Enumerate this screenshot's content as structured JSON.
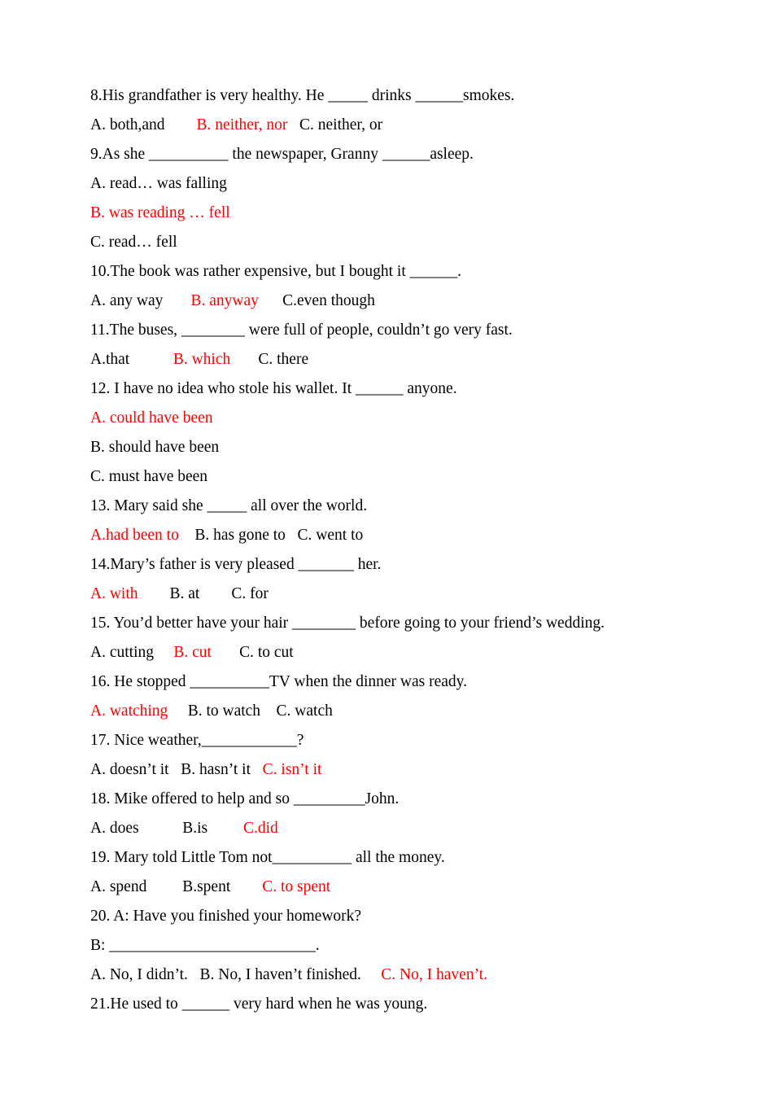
{
  "document": {
    "type": "grammar-multiple-choice-worksheet",
    "accent_color": "#FF0000",
    "text_color": "#000000",
    "background_color": "#FFFFFF",
    "lines": [
      {
        "id": "q8",
        "kind": "question",
        "text": "8.His grandfather is very healthy. He _____ drinks ______smokes."
      },
      {
        "id": "q8-opts",
        "kind": "options",
        "a": "A. both,and",
        "a_red": false,
        "b": "B. neither, nor",
        "b_red": true,
        "c": "C. neither, or",
        "c_red": false,
        "gap1": "        ",
        "gap2": "   "
      },
      {
        "id": "q9",
        "kind": "question",
        "text": "9.As she __________ the newspaper, Granny ______asleep."
      },
      {
        "id": "q9-a",
        "kind": "option-single",
        "text": "A. read… was falling",
        "red": false
      },
      {
        "id": "q9-b",
        "kind": "option-single",
        "text": "B. was reading … fell",
        "red": true
      },
      {
        "id": "q9-c",
        "kind": "option-single",
        "text": "C. read… fell",
        "red": false
      },
      {
        "id": "q10",
        "kind": "question",
        "text": "10.The book was rather expensive, but I bought it ______."
      },
      {
        "id": "q10-opts",
        "kind": "options",
        "a": "A. any way",
        "a_red": false,
        "b": "B. anyway",
        "b_red": true,
        "c": "C.even though",
        "c_red": false,
        "gap1": "       ",
        "gap2": "      "
      },
      {
        "id": "q11",
        "kind": "question",
        "text": "11.The buses, ________ were full of people, couldn’t go very fast."
      },
      {
        "id": "q11-opts",
        "kind": "options",
        "a": "A.that",
        "a_red": false,
        "b": "B. which",
        "b_red": true,
        "c": "C. there",
        "c_red": false,
        "gap1": "           ",
        "gap2": "       "
      },
      {
        "id": "q12",
        "kind": "question",
        "text": "12. I have no idea who stole his wallet. It ______ anyone."
      },
      {
        "id": "q12-a",
        "kind": "option-single",
        "text": "A. could have been",
        "red": true
      },
      {
        "id": "q12-b",
        "kind": "option-single",
        "text": "B. should have been",
        "red": false
      },
      {
        "id": "q12-c",
        "kind": "option-single",
        "text": "C. must have been",
        "red": false
      },
      {
        "id": "q13",
        "kind": "question",
        "text": "13. Mary said she _____ all over the world."
      },
      {
        "id": "q13-opts",
        "kind": "options",
        "a": "A.had been to",
        "a_red": true,
        "b": "B. has gone to",
        "b_red": false,
        "c": "C. went to",
        "c_red": false,
        "gap1": "    ",
        "gap2": "   "
      },
      {
        "id": "q14",
        "kind": "question",
        "text": "14.Mary’s father is very pleased _______ her."
      },
      {
        "id": "q14-opts",
        "kind": "options",
        "a": "A. with",
        "a_red": true,
        "b": "B. at",
        "b_red": false,
        "c": "C. for",
        "c_red": false,
        "gap1": "        ",
        "gap2": "        "
      },
      {
        "id": "q15",
        "kind": "question",
        "text": "15. You’d better have your hair ________ before going to your friend’s wedding."
      },
      {
        "id": "q15-opts",
        "kind": "options",
        "a": "A. cutting",
        "a_red": false,
        "b": "B. cut",
        "b_red": true,
        "c": "C. to cut",
        "c_red": false,
        "gap1": "     ",
        "gap2": "       "
      },
      {
        "id": "q16",
        "kind": "question",
        "text": "16. He stopped __________TV when the dinner was ready."
      },
      {
        "id": "q16-opts",
        "kind": "options",
        "a": "A. watching",
        "a_red": true,
        "b": "B. to watch",
        "b_red": false,
        "c": "C. watch",
        "c_red": false,
        "gap1": "     ",
        "gap2": "    "
      },
      {
        "id": "q17",
        "kind": "question",
        "text": "17. Nice weather,____________?"
      },
      {
        "id": "q17-opts",
        "kind": "options",
        "a": "A. doesn’t it",
        "a_red": false,
        "b": "B. hasn’t it",
        "b_red": false,
        "c": "C. isn’t it",
        "c_red": true,
        "gap1": "   ",
        "gap2": "   "
      },
      {
        "id": "q18",
        "kind": "question",
        "text": "18. Mike offered to help and so _________John."
      },
      {
        "id": "q18-opts",
        "kind": "options",
        "a": "A. does",
        "a_red": false,
        "b": "B.is",
        "b_red": false,
        "c": "C.did",
        "c_red": true,
        "gap1": "           ",
        "gap2": "         "
      },
      {
        "id": "q19",
        "kind": "question",
        "text": "19. Mary told Little Tom not__________ all the money."
      },
      {
        "id": "q19-opts",
        "kind": "options",
        "a": "A. spend",
        "a_red": false,
        "b": "B.spent",
        "b_red": false,
        "c": "C. to spent",
        "c_red": true,
        "gap1": "         ",
        "gap2": "        "
      },
      {
        "id": "q20",
        "kind": "question",
        "text": "20. A: Have you finished your homework?"
      },
      {
        "id": "q20-b",
        "kind": "question",
        "text": "B: __________________________."
      },
      {
        "id": "q20-opts",
        "kind": "options",
        "a": "A. No, I didn’t.",
        "a_red": false,
        "b": "B. No, I haven’t finished.",
        "b_red": false,
        "c": "C. No, I haven’t.",
        "c_red": true,
        "gap1": "   ",
        "gap2": "     "
      },
      {
        "id": "q21",
        "kind": "question",
        "text": "21.He used to ______ very hard when he was young."
      }
    ]
  }
}
